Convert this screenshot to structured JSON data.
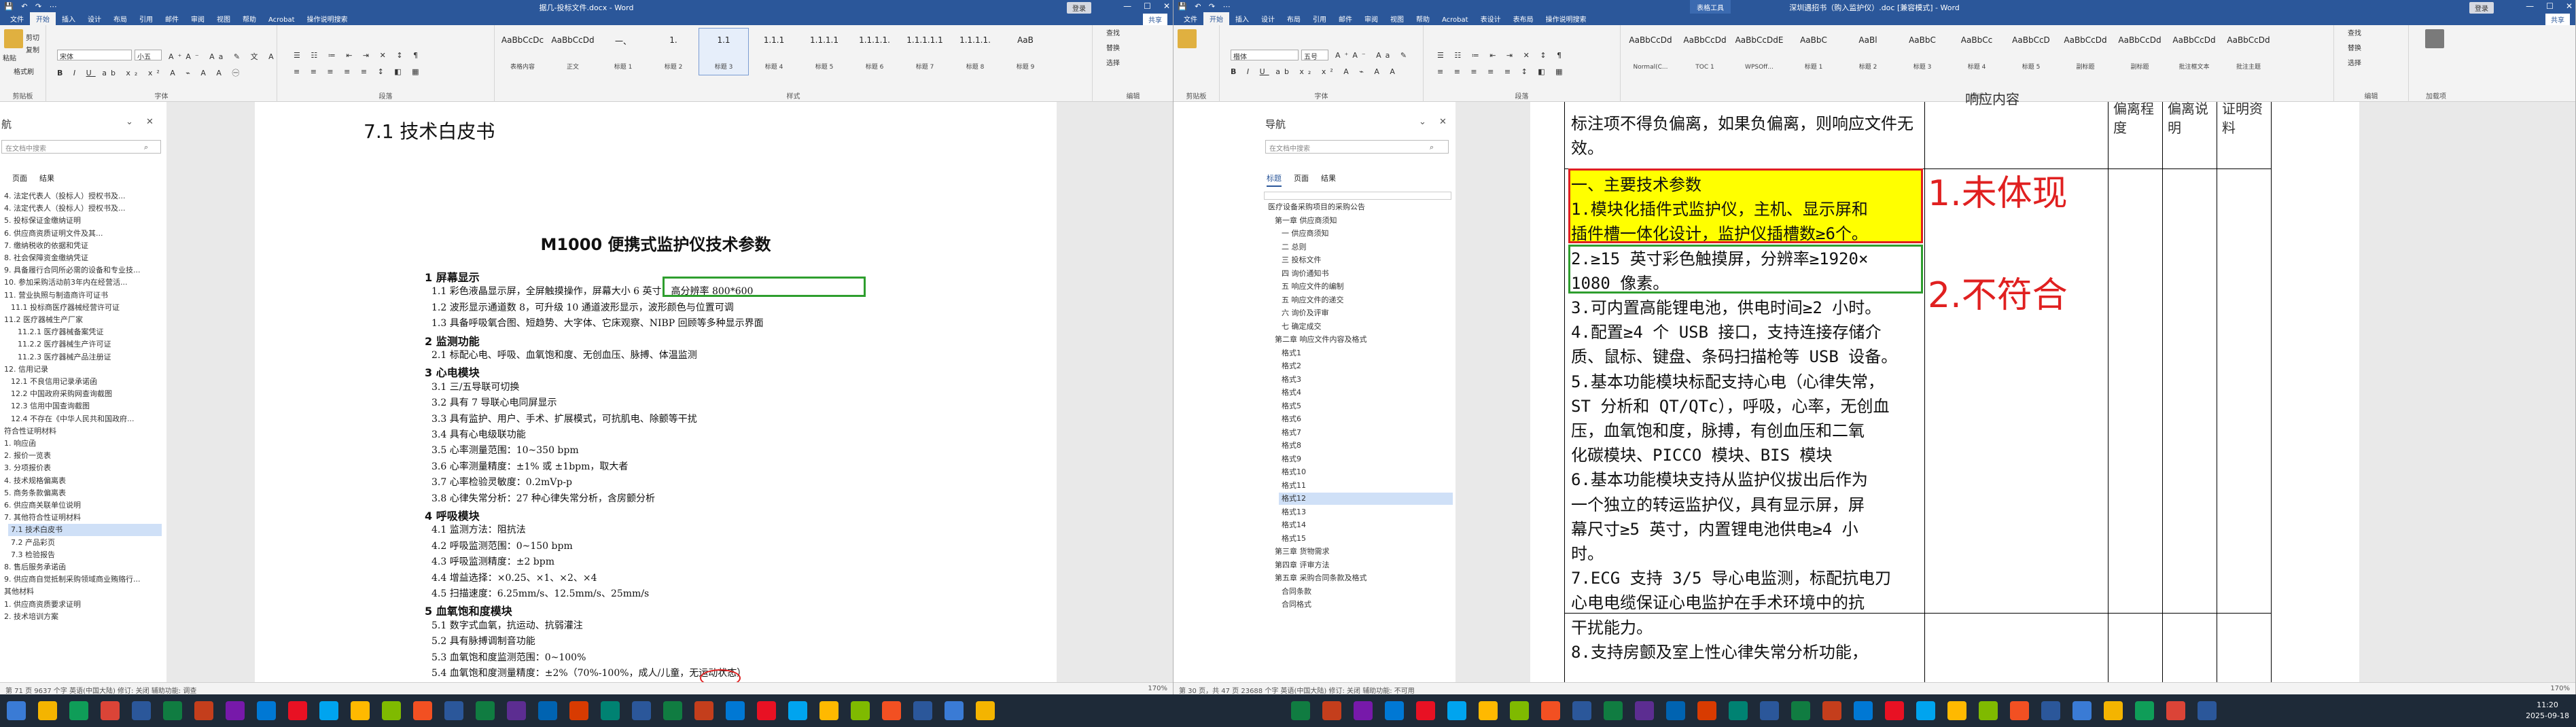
{
  "left_window": {
    "title": "据几-投标文件.docx - Word",
    "login": "登录",
    "share": "共享",
    "tabs": [
      "文件",
      "开始",
      "插入",
      "设计",
      "布局",
      "引用",
      "邮件",
      "审阅",
      "视图",
      "帮助",
      "Acrobat",
      "操作说明搜索"
    ],
    "ribbon": {
      "clipboard": {
        "paste": "粘贴",
        "cut": "剪切",
        "copy": "复制",
        "painter": "格式刷",
        "label": "剪贴板"
      },
      "font": {
        "name": "宋体",
        "size": "小五",
        "label": "字体"
      },
      "paragraph_label": "段落",
      "styles": [
        {
          "preview": "AaBbCcDc",
          "name": "表格内容"
        },
        {
          "preview": "AaBbCcDd",
          "name": "正文"
        },
        {
          "preview": "一、",
          "name": "标题 1"
        },
        {
          "preview": "1.",
          "name": "标题 2"
        },
        {
          "preview": "1.1",
          "name": "标题 3"
        },
        {
          "preview": "1.1.1",
          "name": "标题 4"
        },
        {
          "preview": "1.1.1.1",
          "name": "标题 5"
        },
        {
          "preview": "1.1.1.1.",
          "name": "标题 6"
        },
        {
          "preview": "1.1.1.1.1",
          "name": "标题 7"
        },
        {
          "preview": "1.1.1.1.",
          "name": "标题 8"
        },
        {
          "preview": "AaB",
          "name": "标题 9"
        }
      ],
      "styles_label": "样式",
      "editing": [
        "查找",
        "替换",
        "选择"
      ],
      "editing_label": "编辑"
    },
    "nav": {
      "title": "航",
      "search": "在文档中搜索",
      "tabs": [
        "页面",
        "结果"
      ],
      "items": [
        {
          "text": "4. 法定代表人（投标人）授权书及...",
          "indent": 0
        },
        {
          "text": "4. 法定代表人（投标人）授权书及...",
          "indent": 0
        },
        {
          "text": "5. 投标保证金缴纳证明",
          "indent": 0
        },
        {
          "text": "6. 供应商资质证明文件及其...",
          "indent": 0
        },
        {
          "text": "7. 缴纳税收的依据和凭证",
          "indent": 0
        },
        {
          "text": "8. 社会保障资金缴纳凭证",
          "indent": 0
        },
        {
          "text": "9. 具备履行合同所必需的设备和专业技...",
          "indent": 0
        },
        {
          "text": "10. 参加采购活动前3年内在经营活...",
          "indent": 0
        },
        {
          "text": "11. 营业执照与制造商许可证书",
          "indent": 0
        },
        {
          "text": "11.1 投标商医疗器械经营许可证",
          "indent": 1
        },
        {
          "text": "11.2 医疗器械生产厂家",
          "indent": 0
        },
        {
          "text": "11.2.1 医疗器械备案凭证",
          "indent": 2
        },
        {
          "text": "11.2.2 医疗器械生产许可证",
          "indent": 2
        },
        {
          "text": "11.2.3 医疗器械产品注册证",
          "indent": 2
        },
        {
          "text": "12. 信用记录",
          "indent": 0
        },
        {
          "text": "12.1 不良信用记录承诺函",
          "indent": 1
        },
        {
          "text": "12.2 中国政府采购网查询截图",
          "indent": 1
        },
        {
          "text": "12.3 信用中国查询截图",
          "indent": 1
        },
        {
          "text": "12.4 不存在《中华人民共和国政府...",
          "indent": 1
        },
        {
          "text": "符合性证明材料",
          "indent": 0
        },
        {
          "text": "1. 响应函",
          "indent": 0
        },
        {
          "text": "2. 报价一览表",
          "indent": 0
        },
        {
          "text": "3. 分项报价表",
          "indent": 0
        },
        {
          "text": "4. 技术规格偏离表",
          "indent": 0
        },
        {
          "text": "5. 商务条款偏离表",
          "indent": 0
        },
        {
          "text": "6. 供应商关联单位说明",
          "indent": 0
        },
        {
          "text": "7. 其他符合性证明材料",
          "indent": 0
        },
        {
          "text": "7.1 技术白皮书",
          "indent": 1,
          "selected": true
        },
        {
          "text": "7.2 产品彩页",
          "indent": 1
        },
        {
          "text": "7.3 检验报告",
          "indent": 1
        },
        {
          "text": "8. 售后服务承诺函",
          "indent": 0
        },
        {
          "text": "9. 供应商自觉抵制采购领域商业贿赂行...",
          "indent": 0
        },
        {
          "text": "其他材料",
          "indent": 0
        },
        {
          "text": "1. 供应商资质要求证明",
          "indent": 0
        },
        {
          "text": "2. 技术培训方案",
          "indent": 0
        }
      ]
    },
    "doc": {
      "heading": "7.1    技术白皮书",
      "title": "M1000 便携式监护仪技术参数",
      "lines": [
        {
          "t": "1   屏幕显示",
          "k": "sec"
        },
        {
          "t": "1.1 彩色液晶显示屏，全屏触摸操作，屏幕大小 6 英寸，高分辨率 800*600",
          "k": "it"
        },
        {
          "t": "1.2 波形显示通道数 8，可升级 10 通道波形显示，波形颜色与位置可调",
          "k": "it"
        },
        {
          "t": "1.3 具备呼吸氧合图、短趋势、大字体、它床观察、NIBP 回顾等多种显示界面",
          "k": "it"
        },
        {
          "t": "2   监测功能",
          "k": "sec"
        },
        {
          "t": "2.1 标配心电、呼吸、血氧饱和度、无创血压、脉搏、体温监测",
          "k": "it"
        },
        {
          "t": "3   心电模块",
          "k": "sec"
        },
        {
          "t": "3.1 三/五导联可切换",
          "k": "it"
        },
        {
          "t": "3.2 具有 7 导联心电同屏显示",
          "k": "it"
        },
        {
          "t": "3.3 具有监护、用户、手术、扩展模式，可抗肌电、除颤等干扰",
          "k": "it"
        },
        {
          "t": "3.4 具有心电级联功能",
          "k": "it"
        },
        {
          "t": "3.5 心率测量范围：10~350 bpm",
          "k": "it"
        },
        {
          "t": "3.6 心率测量精度：±1% 或 ±1bpm，取大者",
          "k": "it"
        },
        {
          "t": "3.7 心率检验灵敏度：0.2mVp-p",
          "k": "it"
        },
        {
          "t": "3.8 心律失常分析：27 种心律失常分析，含房颤分析",
          "k": "it"
        },
        {
          "t": "4   呼吸模块",
          "k": "sec"
        },
        {
          "t": "4.1 监测方法：阻抗法",
          "k": "it"
        },
        {
          "t": "4.2 呼吸监测范围：0~150 bpm",
          "k": "it"
        },
        {
          "t": "4.3 呼吸监测精度：±2 bpm",
          "k": "it"
        },
        {
          "t": "4.4 增益选择：×0.25、×1、×2、×4",
          "k": "it"
        },
        {
          "t": "4.5 扫描速度：6.25mm/s、12.5mm/s、25mm/s",
          "k": "it"
        },
        {
          "t": "5   血氧饱和度模块",
          "k": "sec"
        },
        {
          "t": "5.1 数字式血氧，抗运动、抗弱灌注",
          "k": "it"
        },
        {
          "t": "5.2 具有脉搏调制音功能",
          "k": "it"
        },
        {
          "t": "5.3 血氧饱和度监测范围：0~100%",
          "k": "it"
        },
        {
          "t": "5.4 血氧饱和度测量精度：±2%（70%-100%，成人/儿童，无运动状态）",
          "k": "it"
        }
      ]
    },
    "status": {
      "left": "第 71 页   9637 个字   英语(中国大陆)   修订: 关闭   辅助功能: 调查",
      "right": "170%"
    }
  },
  "right_window": {
    "title": "深圳遇招书（购入监护仪）.doc [兼容模式] - Word",
    "context_tab": "表格工具",
    "login": "登录",
    "share": "共享",
    "tabs": [
      "文件",
      "开始",
      "插入",
      "设计",
      "布局",
      "引用",
      "邮件",
      "审阅",
      "视图",
      "帮助",
      "Acrobat",
      "表设计",
      "表布局",
      "操作说明搜索"
    ],
    "ribbon": {
      "font": {
        "name": "楷体",
        "size": "五号"
      },
      "styles": [
        {
          "preview": "AaBbCcDd",
          "name": "Normal(C..."
        },
        {
          "preview": "AaBbCcDd",
          "name": "TOC 1"
        },
        {
          "preview": "AaBbCcDdE",
          "name": "WPSOff..."
        },
        {
          "preview": "AaBbC",
          "name": "标题 1"
        },
        {
          "preview": "AaBl",
          "name": "标题 2"
        },
        {
          "preview": "AaBbC",
          "name": "标题 3"
        },
        {
          "preview": "AaBbCc",
          "name": "标题 4"
        },
        {
          "preview": "AaBbCcD",
          "name": "标题 5"
        },
        {
          "preview": "AaBbCcDd",
          "name": "副标题"
        },
        {
          "preview": "AaBbCcDd",
          "name": "副标题"
        },
        {
          "preview": "AaBbCcDd",
          "name": "批注框文本"
        },
        {
          "preview": "AaBbCcDd",
          "name": "批注主题"
        }
      ],
      "editing": [
        "查找",
        "替换",
        "选择"
      ],
      "labels": [
        "剪贴板",
        "字体",
        "段落",
        "样式",
        "编辑",
        "加载项"
      ]
    },
    "nav": {
      "title": "导航",
      "search": "在文档中搜索",
      "tabs": [
        "标题",
        "页面",
        "结果"
      ],
      "items": [
        {
          "text": "医疗设备采购项目的采购公告",
          "indent": 0
        },
        {
          "text": "第一章 供应商须知",
          "indent": 1
        },
        {
          "text": "一 供应商须知",
          "indent": 2
        },
        {
          "text": "二 总则",
          "indent": 2
        },
        {
          "text": "三 投标文件",
          "indent": 2
        },
        {
          "text": "四 询价通知书",
          "indent": 2
        },
        {
          "text": "五 响应文件的编制",
          "indent": 2
        },
        {
          "text": "五 响应文件的递交",
          "indent": 2
        },
        {
          "text": "六 询价及评审",
          "indent": 2
        },
        {
          "text": "七 确定成交",
          "indent": 2
        },
        {
          "text": "第二章 响应文件内容及格式",
          "indent": 1
        },
        {
          "text": "格式1",
          "indent": 2
        },
        {
          "text": "格式2",
          "indent": 2
        },
        {
          "text": "格式3",
          "indent": 2
        },
        {
          "text": "格式4",
          "indent": 2
        },
        {
          "text": "格式5",
          "indent": 2
        },
        {
          "text": "格式6",
          "indent": 2
        },
        {
          "text": "格式7",
          "indent": 2
        },
        {
          "text": "格式8",
          "indent": 2
        },
        {
          "text": "格式9",
          "indent": 2
        },
        {
          "text": "格式10",
          "indent": 2
        },
        {
          "text": "格式11",
          "indent": 2
        },
        {
          "text": "格式12",
          "indent": 2,
          "selected": true
        },
        {
          "text": "格式13",
          "indent": 2
        },
        {
          "text": "格式14",
          "indent": 2
        },
        {
          "text": "格式15",
          "indent": 2
        },
        {
          "text": "第三章 货物需求",
          "indent": 1
        },
        {
          "text": "第四章 评审方法",
          "indent": 1
        },
        {
          "text": "第五章 采购合同条款及格式",
          "indent": 1
        },
        {
          "text": "合同条款",
          "indent": 2
        },
        {
          "text": "合同格式",
          "indent": 2
        }
      ]
    },
    "doc": {
      "header_cols": [
        "响应内容",
        "偏离程度",
        "偏离说明",
        "证明资料"
      ],
      "intro": [
        "标注项不得负偏离，如果负偏离，则响应文件无",
        "效。"
      ],
      "lines": [
        "一、主要技术参数",
        "1.模块化插件式监护仪，主机、显示屏和",
        "插件槽一体化设计，监护仪插槽数≥6个。",
        "2.≥15 英寸彩色触摸屏，分辨率≥1920×",
        "1080 像素。",
        "3.可内置高能锂电池，供电时间≥2 小时。",
        "4.配置≥4 个 USB 接口，支持连接存储介",
        "质、鼠标、键盘、条码扫描枪等 USB 设备。",
        "5.基本功能模块标配支持心电（心律失常，",
        "ST 分析和 QT/QTc），呼吸，心率，无创血",
        "压，血氧饱和度，脉搏，有创血压和二氧",
        "化碳模块、PICCO 模块、BIS 模块",
        "6.基本功能模块支持从监护仪拔出后作为",
        "一个独立的转运监护仪，具有显示屏，屏",
        "幕尺寸≥5 英寸，内置锂电池供电≥4 小",
        "时。",
        "7.ECG 支持 3/5 导心电监测，标配抗电刀",
        "心电电缆保证心电监护在手术环境中的抗",
        "干扰能力。",
        "8.支持房颤及室上性心律失常分析功能，"
      ],
      "annotations": [
        "1.未体现",
        "2.不符合"
      ]
    },
    "status": {
      "left": "第 30 页，共 47 页   23688 个字   英语(中国大陆)   修订: 关闭   辅助功能: 不可用",
      "right": "170%"
    }
  },
  "taskbar": {
    "time": "11:20",
    "date": "2025-09-18"
  },
  "colors": {
    "word_blue": "#2b579a",
    "highlight_yellow": "#ffff00",
    "red_box": "#e02020",
    "green_box": "#2e9e2e",
    "annotation_red": "#e02020"
  }
}
